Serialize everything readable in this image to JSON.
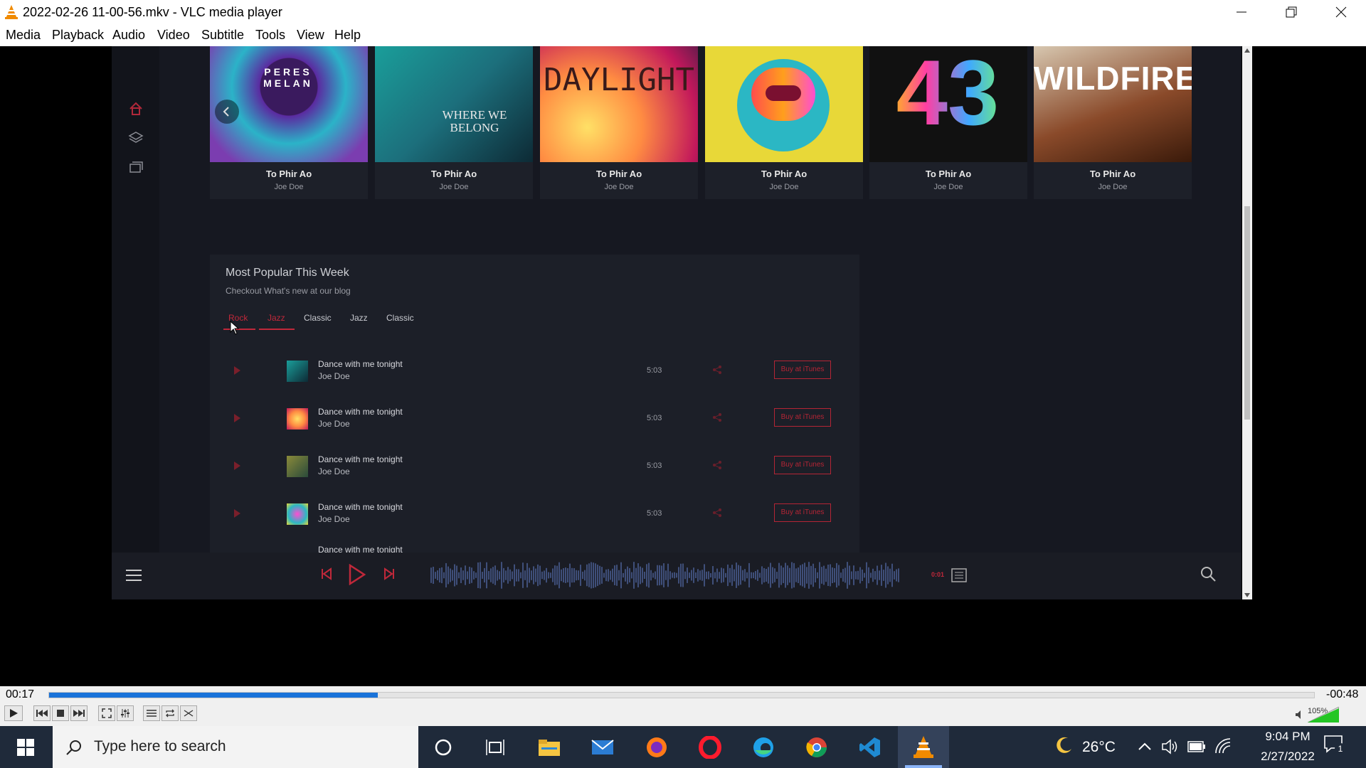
{
  "window": {
    "title": "2022-02-26 11-00-56.mkv - VLC media player"
  },
  "menu": [
    "Media",
    "Playback",
    "Audio",
    "Video",
    "Subtitle",
    "Tools",
    "View",
    "Help"
  ],
  "albums": [
    {
      "cover_text": "PERES MELAN",
      "title": "To Phir Ao",
      "artist": "Joe Doe"
    },
    {
      "cover_text": "WHERE WE BELONG",
      "title": "To Phir Ao",
      "artist": "Joe Doe"
    },
    {
      "cover_text": "DAYLIGHT",
      "title": "To Phir Ao",
      "artist": "Joe Doe"
    },
    {
      "cover_text": "",
      "title": "To Phir Ao",
      "artist": "Joe Doe"
    },
    {
      "cover_text": "43",
      "title": "To Phir Ao",
      "artist": "Joe Doe"
    },
    {
      "cover_text": "WILDFIRE",
      "title": "To Phir Ao",
      "artist": "Joe Doe"
    }
  ],
  "popular": {
    "title": "Most Popular This Week",
    "subtitle": "Checkout What's new at our blog",
    "tabs": [
      "Rock",
      "Jazz",
      "Classic",
      "Jazz",
      "Classic"
    ],
    "tracks": [
      {
        "title": "Dance with me tonight",
        "artist": "Joe Doe",
        "duration": "5:03",
        "buy": "Buy at iTunes"
      },
      {
        "title": "Dance with me tonight",
        "artist": "Joe Doe",
        "duration": "5:03",
        "buy": "Buy at iTunes"
      },
      {
        "title": "Dance with me tonight",
        "artist": "Joe Doe",
        "duration": "5:03",
        "buy": "Buy at iTunes"
      },
      {
        "title": "Dance with me tonight",
        "artist": "Joe Doe",
        "duration": "5:03",
        "buy": "Buy at iTunes"
      },
      {
        "title": "Dance with me tonight",
        "artist": "",
        "duration": "",
        "buy": ""
      }
    ]
  },
  "player": {
    "elapsed": "0:01"
  },
  "vlc": {
    "time_elapsed": "00:17",
    "time_remaining": "-00:48",
    "progress_fraction": 0.26,
    "volume": "105%"
  },
  "taskbar": {
    "search_placeholder": "Type here to search",
    "temperature": "26°C",
    "time": "9:04 PM",
    "date": "2/27/2022",
    "notifications": "1"
  },
  "colors": {
    "accent": "#c0283a",
    "vlc_orange": "#f08a00",
    "progress": "#1a73d9"
  }
}
